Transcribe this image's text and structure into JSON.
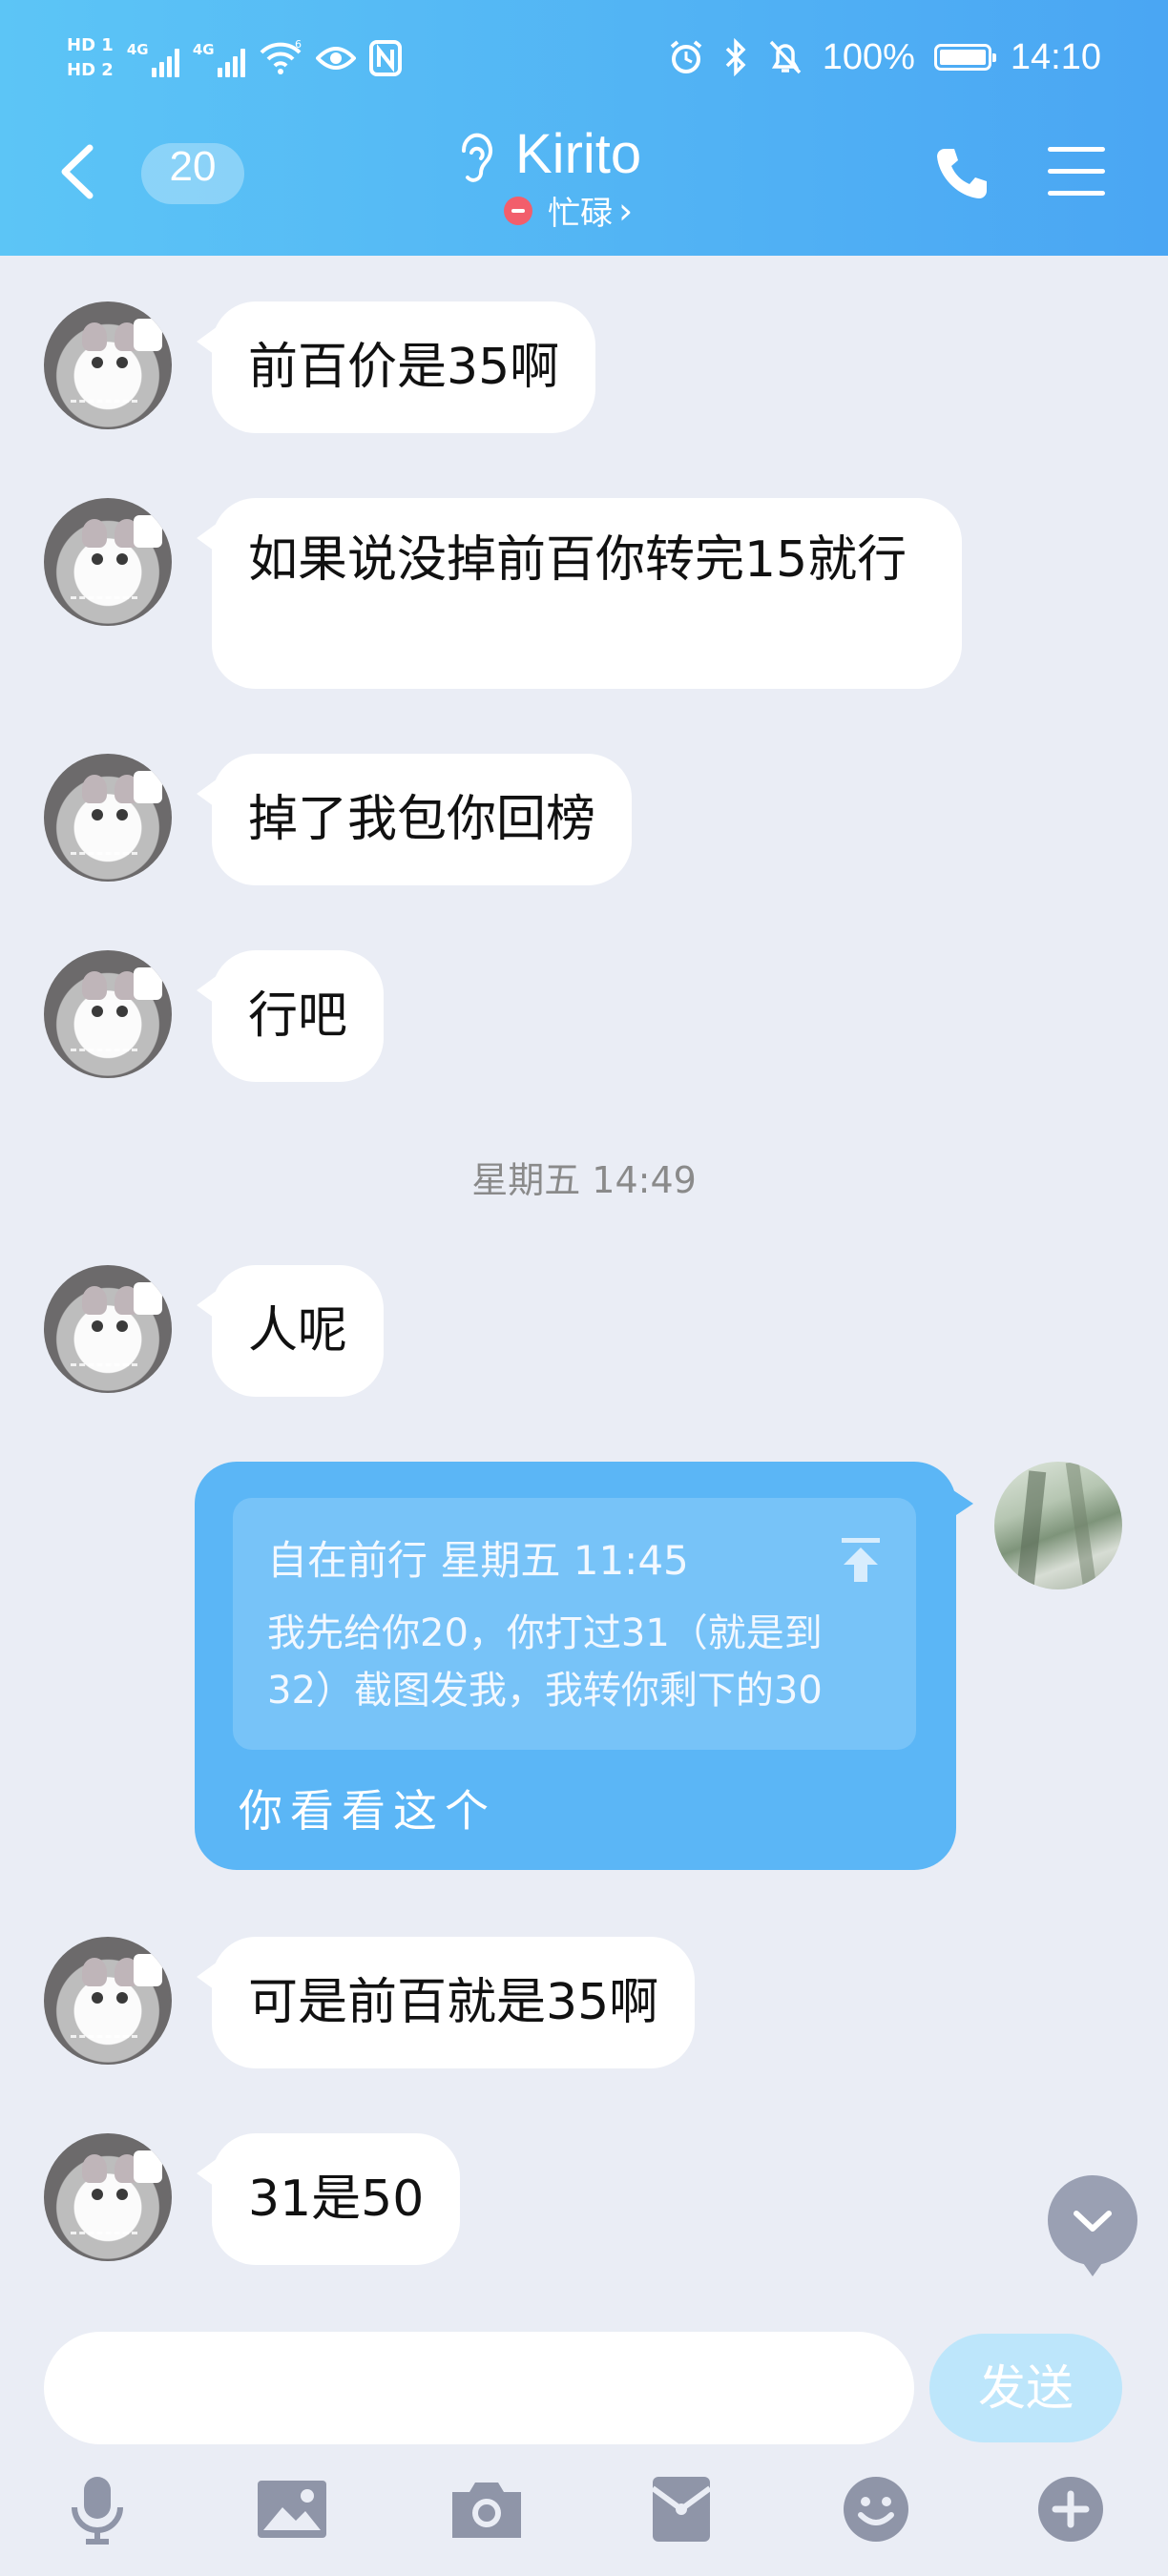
{
  "status_bar": {
    "hd1": "HD",
    "hd2": "HD",
    "sim1": "1",
    "sim2": "2",
    "net1": "4G",
    "net2": "4G",
    "wifi_gen": "6",
    "battery": "100%",
    "time": "14:10"
  },
  "header": {
    "unread_count": "20",
    "contact_name": "Kirito",
    "contact_status": "忙碌",
    "status_chevron": "›"
  },
  "messages": [
    {
      "sender": "other",
      "text": "前百价是35啊"
    },
    {
      "sender": "other",
      "text": "如果说没掉前百你转完15就行"
    },
    {
      "sender": "other",
      "text": "掉了我包你回榜"
    },
    {
      "sender": "other",
      "text": "行吧"
    },
    {
      "sender": "other",
      "text": "人呢"
    },
    {
      "sender": "other",
      "text": "可是前百就是35啊"
    },
    {
      "sender": "other",
      "text": "31是50"
    }
  ],
  "time_separator": "星期五 14:49",
  "self_message": {
    "quote_author": "自在前行",
    "quote_time": "星期五 11:45",
    "quote_text": "我先给你20，你打过31（就是到32）截图发我，我转你剩下的30",
    "reply": "你看看这个"
  },
  "input": {
    "placeholder": "",
    "send_label": "发送"
  },
  "toolbar": [
    "microphone-icon",
    "image-icon",
    "camera-icon",
    "red-packet-icon",
    "emoji-icon",
    "plus-icon"
  ],
  "colors": {
    "header_gradient_start": "#5cc5f6",
    "header_gradient_end": "#4aa6f3",
    "self_bubble": "#5bb6f6",
    "background": "#eaedf5",
    "busy": "#f25e6b"
  }
}
